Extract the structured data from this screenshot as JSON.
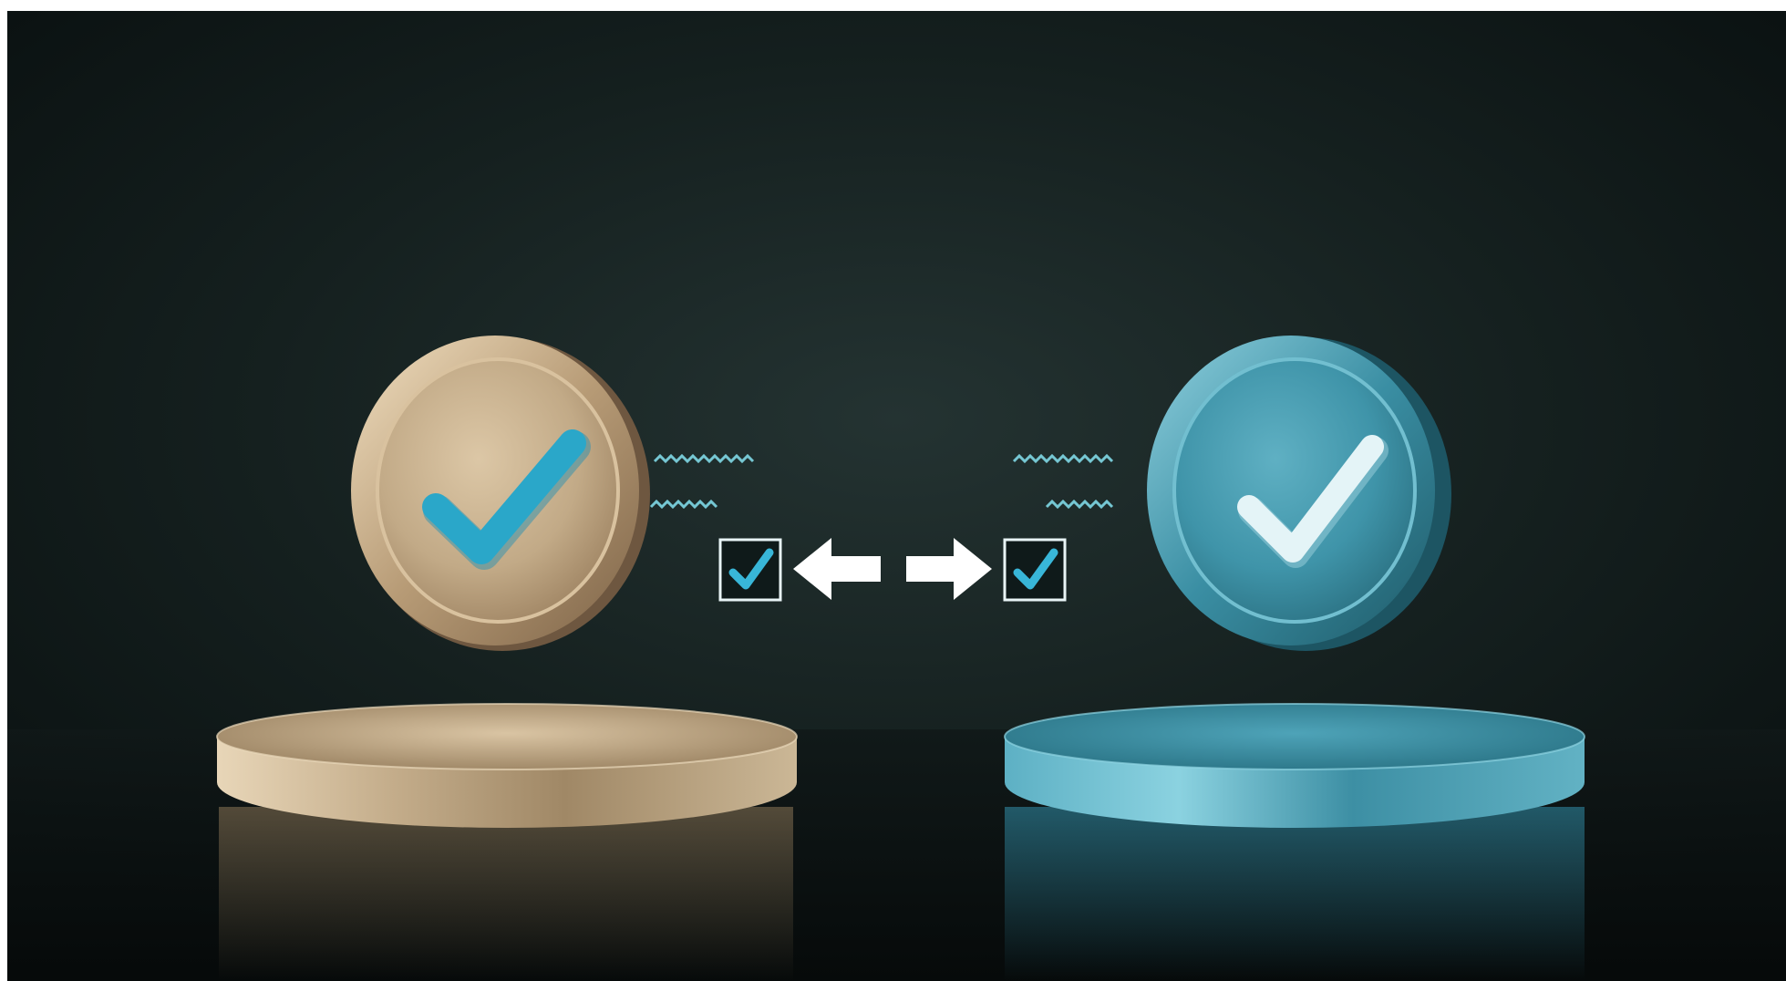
{
  "scene": {
    "background_color": "#14201f",
    "left_token": {
      "color": "#c9b393",
      "rim_color": "#a9896a",
      "check_color": "#2aa7c9",
      "icon": "check-icon"
    },
    "right_token": {
      "color": "#3f95ab",
      "rim_color": "#2e7e93",
      "check_color": "#dff2f6",
      "icon": "check-icon"
    },
    "left_pedestal_color": "#b9a587",
    "right_pedestal_color": "#3c95ad",
    "exchange": {
      "left_checkbox_icon": "checkbox-checked-icon",
      "right_checkbox_icon": "checkbox-checked-icon",
      "left_arrow_icon": "arrow-left-icon",
      "right_arrow_icon": "arrow-right-icon",
      "checkbox_check_color": "#38b6d8",
      "arrow_color": "#ffffff"
    },
    "signal_color": "#7fd8e6"
  }
}
